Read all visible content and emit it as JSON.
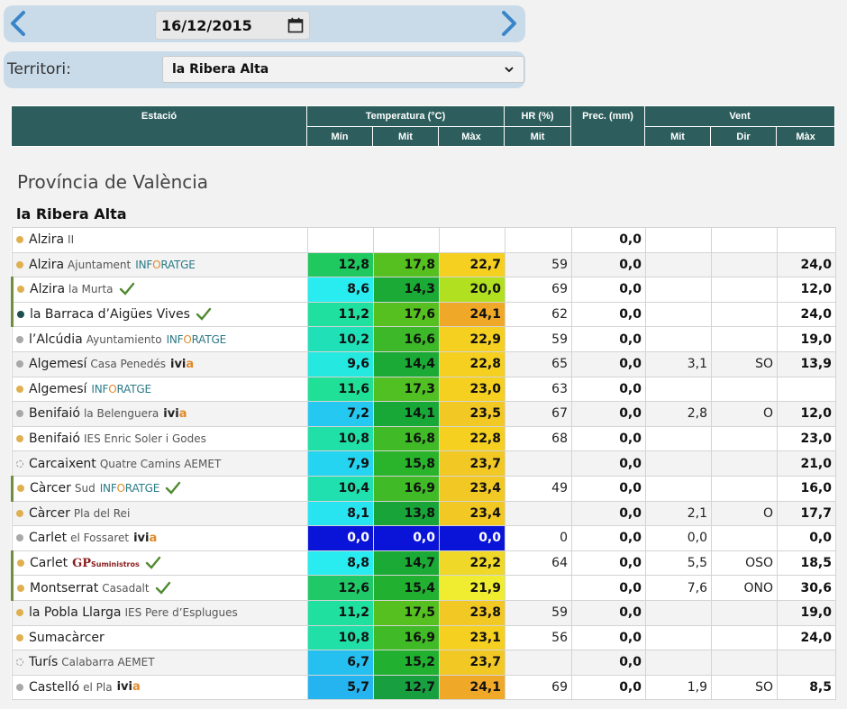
{
  "date_nav": {
    "date_value": "16/12/2015"
  },
  "territory": {
    "label": "Territori:",
    "selected": "la Ribera Alta"
  },
  "table_header": {
    "station": "Estació",
    "temperature": "Temperatura (°C)",
    "hr": "HR (%)",
    "prec": "Prec. (mm)",
    "wind": "Vent",
    "min": "Mín",
    "mit": "Mit",
    "max": "Màx",
    "hr_mit": "Mit",
    "wind_mit": "Mit",
    "wind_dir": "Dir",
    "wind_max": "Màx"
  },
  "province_title": "Província de València",
  "territory_title": "la Ribera Alta",
  "colors": {
    "header_bg": "#2d5e5d",
    "dot_orange": "#e0b050",
    "dot_grey": "#a8a8a8",
    "dot_dark": "#1f4f4f",
    "check_green": "#4f8a2f"
  },
  "stations": [
    {
      "name": "Alzira",
      "sub": "II",
      "brand": "",
      "dot": "orange",
      "check": false,
      "mark": false,
      "tmin": "",
      "tmit": "",
      "tmax": "",
      "hr": "",
      "prec": "0,0",
      "wmit": "",
      "wdir": "",
      "wmax": "",
      "cmin": "",
      "cmit": "",
      "cmax": ""
    },
    {
      "name": "Alzira",
      "sub": "Ajuntament",
      "brand": "inforatge",
      "dot": "orange",
      "check": false,
      "mark": false,
      "tmin": "12,8",
      "tmit": "17,8",
      "tmax": "22,7",
      "hr": "59",
      "prec": "0,0",
      "wmit": "",
      "wdir": "",
      "wmax": "24,0",
      "cmin": "#20c860",
      "cmit": "#55c020",
      "cmax": "#f5d020"
    },
    {
      "name": "Alzira",
      "sub": "la Murta",
      "brand": "",
      "dot": "orange",
      "check": true,
      "mark": true,
      "tmin": "8,6",
      "tmit": "14,3",
      "tmax": "20,0",
      "hr": "69",
      "prec": "0,0",
      "wmit": "",
      "wdir": "",
      "wmax": "12,0",
      "cmin": "#28ecf0",
      "cmit": "#1aaa35",
      "cmax": "#b0e020"
    },
    {
      "name": "la Barraca d’Aigües Vives",
      "sub": "",
      "brand": "",
      "dot": "dark",
      "check": true,
      "mark": true,
      "tmin": "11,2",
      "tmit": "17,6",
      "tmax": "24,1",
      "hr": "62",
      "prec": "0,0",
      "wmit": "",
      "wdir": "",
      "wmax": "24,0",
      "cmin": "#20e0a0",
      "cmit": "#55c020",
      "cmax": "#f0a828"
    },
    {
      "name": "l’Alcúdia",
      "sub": "Ayuntamiento",
      "brand": "inforatge",
      "dot": "grey",
      "check": false,
      "mark": false,
      "tmin": "10,2",
      "tmit": "16,6",
      "tmax": "22,9",
      "hr": "59",
      "prec": "0,0",
      "wmit": "",
      "wdir": "",
      "wmax": "19,0",
      "cmin": "#20e0b8",
      "cmit": "#3cb828",
      "cmax": "#f5d020"
    },
    {
      "name": "Algemesí",
      "sub": "Casa Penedés",
      "brand": "ivia",
      "dot": "grey",
      "check": false,
      "mark": false,
      "tmin": "9,6",
      "tmit": "14,4",
      "tmax": "22,8",
      "hr": "65",
      "prec": "0,0",
      "wmit": "3,1",
      "wdir": "SO",
      "wmax": "13,9",
      "cmin": "#25e8e0",
      "cmit": "#1aaa35",
      "cmax": "#f5d020"
    },
    {
      "name": "Algemesí",
      "sub": "",
      "brand": "inforatge",
      "dot": "orange",
      "check": false,
      "mark": false,
      "tmin": "11,6",
      "tmit": "17,3",
      "tmax": "23,0",
      "hr": "63",
      "prec": "0,0",
      "wmit": "",
      "wdir": "",
      "wmax": "",
      "cmin": "#20e098",
      "cmit": "#50c022",
      "cmax": "#f5d020"
    },
    {
      "name": "Benifaió",
      "sub": "la Belenguera",
      "brand": "ivia",
      "dot": "grey",
      "check": false,
      "mark": false,
      "tmin": "7,2",
      "tmit": "14,1",
      "tmax": "23,5",
      "hr": "67",
      "prec": "0,0",
      "wmit": "2,8",
      "wdir": "O",
      "wmax": "12,0",
      "cmin": "#25c8f0",
      "cmit": "#18a838",
      "cmax": "#f2c825"
    },
    {
      "name": "Benifaió",
      "sub": "IES Enric Soler i Godes",
      "brand": "",
      "dot": "orange",
      "check": false,
      "mark": false,
      "tmin": "10,8",
      "tmit": "16,8",
      "tmax": "22,8",
      "hr": "68",
      "prec": "0,0",
      "wmit": "",
      "wdir": "",
      "wmax": "23,0",
      "cmin": "#20e0a8",
      "cmit": "#40ba26",
      "cmax": "#f5d020"
    },
    {
      "name": "Carcaixent",
      "sub": "Quatre Camins AEMET",
      "brand": "",
      "dot": "dashed",
      "check": false,
      "mark": false,
      "tmin": "7,9",
      "tmit": "15,8",
      "tmax": "23,7",
      "hr": "",
      "prec": "0,0",
      "wmit": "",
      "wdir": "",
      "wmax": "21,0",
      "cmin": "#25d4f0",
      "cmit": "#2ab42c",
      "cmax": "#f2c825"
    },
    {
      "name": "Càrcer",
      "sub": "Sud",
      "brand": "inforatge",
      "dot": "orange",
      "check": true,
      "mark": true,
      "tmin": "10,4",
      "tmit": "16,9",
      "tmax": "23,4",
      "hr": "49",
      "prec": "0,0",
      "wmit": "",
      "wdir": "",
      "wmax": "16,0",
      "cmin": "#20e0b0",
      "cmit": "#40ba26",
      "cmax": "#f2c825"
    },
    {
      "name": "Càrcer",
      "sub": "Pla del Rei",
      "brand": "",
      "dot": "orange",
      "check": false,
      "mark": false,
      "tmin": "8,1",
      "tmit": "13,8",
      "tmax": "23,4",
      "hr": "",
      "prec": "0,0",
      "wmit": "2,1",
      "wdir": "O",
      "wmax": "17,7",
      "cmin": "#28e4f0",
      "cmit": "#18a438",
      "cmax": "#f2c825"
    },
    {
      "name": "Carlet",
      "sub": "el Fossaret",
      "brand": "ivia",
      "dot": "grey",
      "check": false,
      "mark": false,
      "tmin": "0,0",
      "tmit": "0,0",
      "tmax": "0,0",
      "hr": "0",
      "prec": "0,0",
      "wmit": "0,0",
      "wdir": "",
      "wmax": "0,0",
      "cmin": "#0a14d8",
      "cmit": "#0a14d8",
      "cmax": "#0a14d8"
    },
    {
      "name": "Carlet",
      "sub": "",
      "brand": "gp",
      "dot": "orange",
      "check": true,
      "mark": true,
      "tmin": "8,8",
      "tmit": "14,7",
      "tmax": "22,2",
      "hr": "64",
      "prec": "0,0",
      "wmit": "5,5",
      "wdir": "OSO",
      "wmax": "18,5",
      "cmin": "#28ecf0",
      "cmit": "#1aaa35",
      "cmax": "#f0d828"
    },
    {
      "name": "Montserrat",
      "sub": "Casadalt",
      "brand": "",
      "dot": "orange",
      "check": true,
      "mark": true,
      "tmin": "12,6",
      "tmit": "15,4",
      "tmax": "21,9",
      "hr": "",
      "prec": "0,0",
      "wmit": "7,6",
      "wdir": "ONO",
      "wmax": "30,6",
      "cmin": "#20c868",
      "cmit": "#22b030",
      "cmax": "#f0ec30"
    },
    {
      "name": "la Pobla Llarga",
      "sub": "IES Pere d’Esplugues",
      "brand": "",
      "dot": "orange",
      "check": false,
      "mark": false,
      "tmin": "11,2",
      "tmit": "17,5",
      "tmax": "23,8",
      "hr": "59",
      "prec": "0,0",
      "wmit": "",
      "wdir": "",
      "wmax": "19,0",
      "cmin": "#20e0a0",
      "cmit": "#55c020",
      "cmax": "#f2c825"
    },
    {
      "name": "Sumacàrcer",
      "sub": "",
      "brand": "",
      "dot": "orange",
      "check": false,
      "mark": false,
      "tmin": "10,8",
      "tmit": "16,9",
      "tmax": "23,1",
      "hr": "56",
      "prec": "0,0",
      "wmit": "",
      "wdir": "",
      "wmax": "24,0",
      "cmin": "#20e0a8",
      "cmit": "#40ba26",
      "cmax": "#f5d020"
    },
    {
      "name": "Turís",
      "sub": "Calabarra AEMET",
      "brand": "",
      "dot": "dashed",
      "check": false,
      "mark": false,
      "tmin": "6,7",
      "tmit": "15,2",
      "tmax": "23,7",
      "hr": "",
      "prec": "0,0",
      "wmit": "",
      "wdir": "",
      "wmax": "",
      "cmin": "#25c0f0",
      "cmit": "#22b030",
      "cmax": "#f2c825"
    },
    {
      "name": "Castelló",
      "sub": "el Pla",
      "brand": "ivia",
      "dot": "grey",
      "check": false,
      "mark": false,
      "tmin": "5,7",
      "tmit": "12,7",
      "tmax": "24,1",
      "hr": "69",
      "prec": "0,0",
      "wmit": "1,9",
      "wdir": "SO",
      "wmax": "8,5",
      "cmin": "#25b4f0",
      "cmit": "#18a040",
      "cmax": "#f0a828"
    }
  ]
}
